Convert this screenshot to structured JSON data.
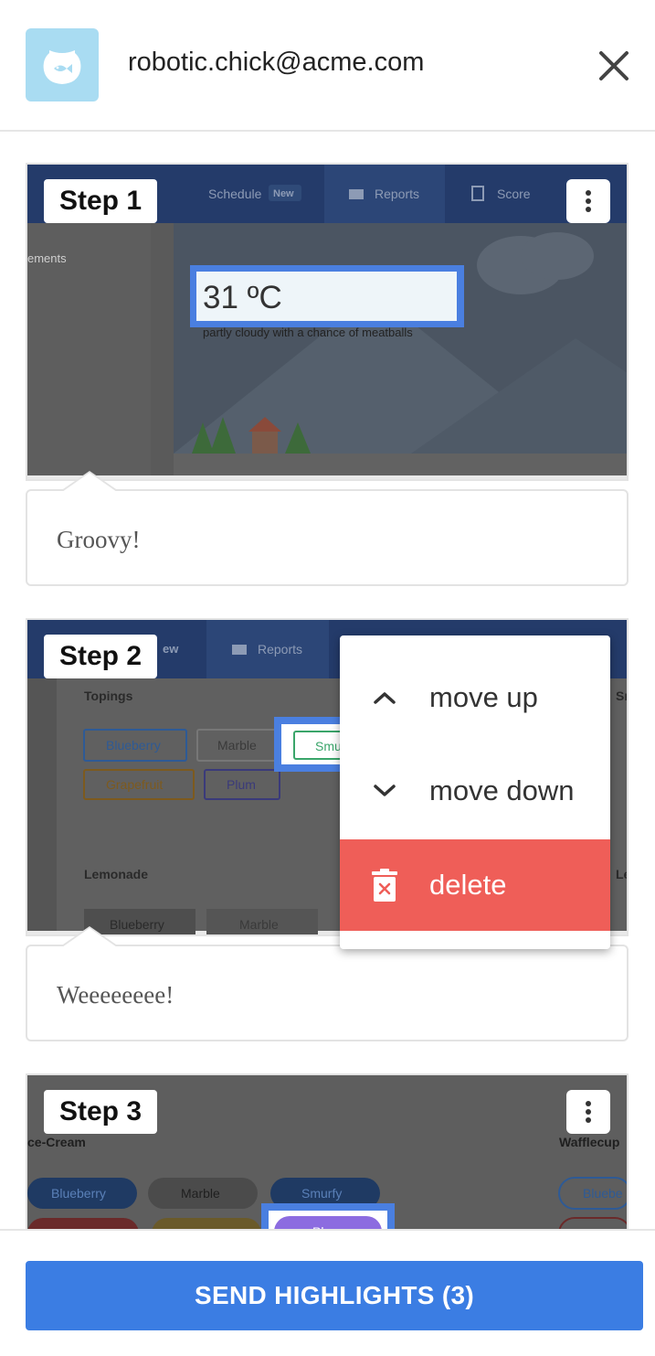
{
  "header": {
    "email": "robotic.chick@acme.com",
    "avatar_icon": "fishbowl-icon",
    "close_icon": "close-icon"
  },
  "steps": [
    {
      "badge": "Step 1",
      "comment": "Groovy!",
      "screenshot": {
        "nav": [
          "Schedule",
          "New",
          "Reports",
          "Score"
        ],
        "sidebar_text": "ements",
        "weather_value": "31 ºC",
        "weather_caption": "partly cloudy with a chance of meatballs"
      }
    },
    {
      "badge": "Step 2",
      "comment": "Weeeeeeee!",
      "screenshot": {
        "nav_fragment": "ew",
        "nav_reports": "Reports",
        "section1": "Topings",
        "chips_row1": [
          "Blueberry",
          "Marble",
          "Smu"
        ],
        "chips_row2": [
          "Grapefruit",
          "Plum"
        ],
        "section2": "Lemonade",
        "chips_row3": [
          "Blueberry",
          "Marble"
        ],
        "right_fragment_1": "Sr",
        "right_fragment_2": "Le"
      }
    },
    {
      "badge": "Step 3",
      "screenshot": {
        "section1": "ce-Cream",
        "section2": "Wafflecup",
        "chips": [
          "Blueberry",
          "Marble",
          "Smurfy",
          "Plum"
        ],
        "right_chip": "Bluebe"
      }
    }
  ],
  "menu": {
    "move_up": "move up",
    "move_down": "move down",
    "delete": "delete"
  },
  "footer": {
    "send_label": "SEND HIGHLIGHTS (3)"
  },
  "colors": {
    "accent": "#3b7de3",
    "danger": "#ef5e58",
    "highlight": "#4a7fe0",
    "avatar_bg": "#a9dcf2"
  }
}
